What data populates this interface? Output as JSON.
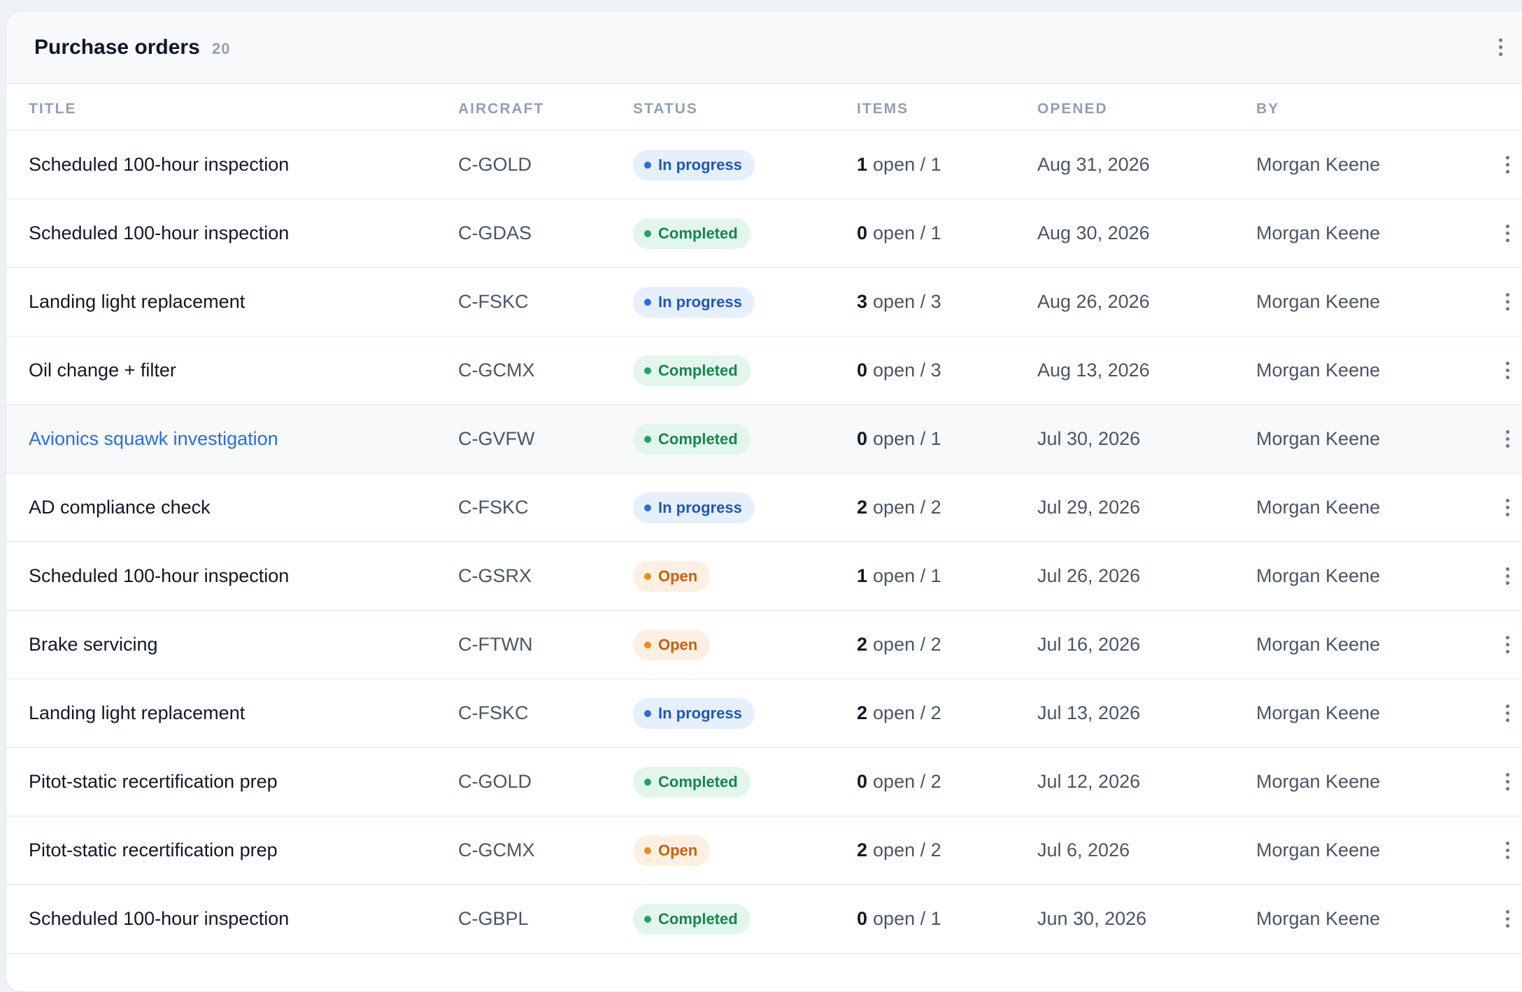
{
  "panel": {
    "title": "Purchase orders",
    "count": "20"
  },
  "columns": {
    "title": "TITLE",
    "aircraft": "AIRCRAFT",
    "status": "STATUS",
    "items": "ITEMS",
    "opened": "OPENED",
    "by": "BY"
  },
  "status_styles": {
    "In progress": {
      "bg": "#e6effc",
      "fg": "#2057b8",
      "dot": "#2a6fd6"
    },
    "Completed": {
      "bg": "#e3f6ec",
      "fg": "#16864f",
      "dot": "#1fa463"
    },
    "Open": {
      "bg": "#fdf0e3",
      "fg": "#c6600f",
      "dot": "#f08a1c"
    }
  },
  "link_color": "#2a6fd6",
  "rows": [
    {
      "title": "Scheduled 100-hour inspection",
      "aircraft": "C-GOLD",
      "status": "In progress",
      "items_open": "1",
      "items_rest": "open / 1",
      "opened": "Aug 31, 2026",
      "by": "Morgan Keene"
    },
    {
      "title": "Scheduled 100-hour inspection",
      "aircraft": "C-GDAS",
      "status": "Completed",
      "items_open": "0",
      "items_rest": "open / 1",
      "opened": "Aug 30, 2026",
      "by": "Morgan Keene"
    },
    {
      "title": "Landing light replacement",
      "aircraft": "C-FSKC",
      "status": "In progress",
      "items_open": "3",
      "items_rest": "open / 3",
      "opened": "Aug 26, 2026",
      "by": "Morgan Keene"
    },
    {
      "title": "Oil change + filter",
      "aircraft": "C-GCMX",
      "status": "Completed",
      "items_open": "0",
      "items_rest": "open / 3",
      "opened": "Aug 13, 2026",
      "by": "Morgan Keene"
    },
    {
      "title": "Avionics squawk investigation",
      "aircraft": "C-GVFW",
      "status": "Completed",
      "items_open": "0",
      "items_rest": "open / 1",
      "opened": "Jul 30, 2026",
      "by": "Morgan Keene",
      "hovered": true
    },
    {
      "title": "AD compliance check",
      "aircraft": "C-FSKC",
      "status": "In progress",
      "items_open": "2",
      "items_rest": "open / 2",
      "opened": "Jul 29, 2026",
      "by": "Morgan Keene"
    },
    {
      "title": "Scheduled 100-hour inspection",
      "aircraft": "C-GSRX",
      "status": "Open",
      "items_open": "1",
      "items_rest": "open / 1",
      "opened": "Jul 26, 2026",
      "by": "Morgan Keene"
    },
    {
      "title": "Brake servicing",
      "aircraft": "C-FTWN",
      "status": "Open",
      "items_open": "2",
      "items_rest": "open / 2",
      "opened": "Jul 16, 2026",
      "by": "Morgan Keene"
    },
    {
      "title": "Landing light replacement",
      "aircraft": "C-FSKC",
      "status": "In progress",
      "items_open": "2",
      "items_rest": "open / 2",
      "opened": "Jul 13, 2026",
      "by": "Morgan Keene"
    },
    {
      "title": "Pitot-static recertification prep",
      "aircraft": "C-GOLD",
      "status": "Completed",
      "items_open": "0",
      "items_rest": "open / 2",
      "opened": "Jul 12, 2026",
      "by": "Morgan Keene"
    },
    {
      "title": "Pitot-static recertification prep",
      "aircraft": "C-GCMX",
      "status": "Open",
      "items_open": "2",
      "items_rest": "open / 2",
      "opened": "Jul 6, 2026",
      "by": "Morgan Keene"
    },
    {
      "title": "Scheduled 100-hour inspection",
      "aircraft": "C-GBPL",
      "status": "Completed",
      "items_open": "0",
      "items_rest": "open / 1",
      "opened": "Jun 30, 2026",
      "by": "Morgan Keene"
    }
  ]
}
